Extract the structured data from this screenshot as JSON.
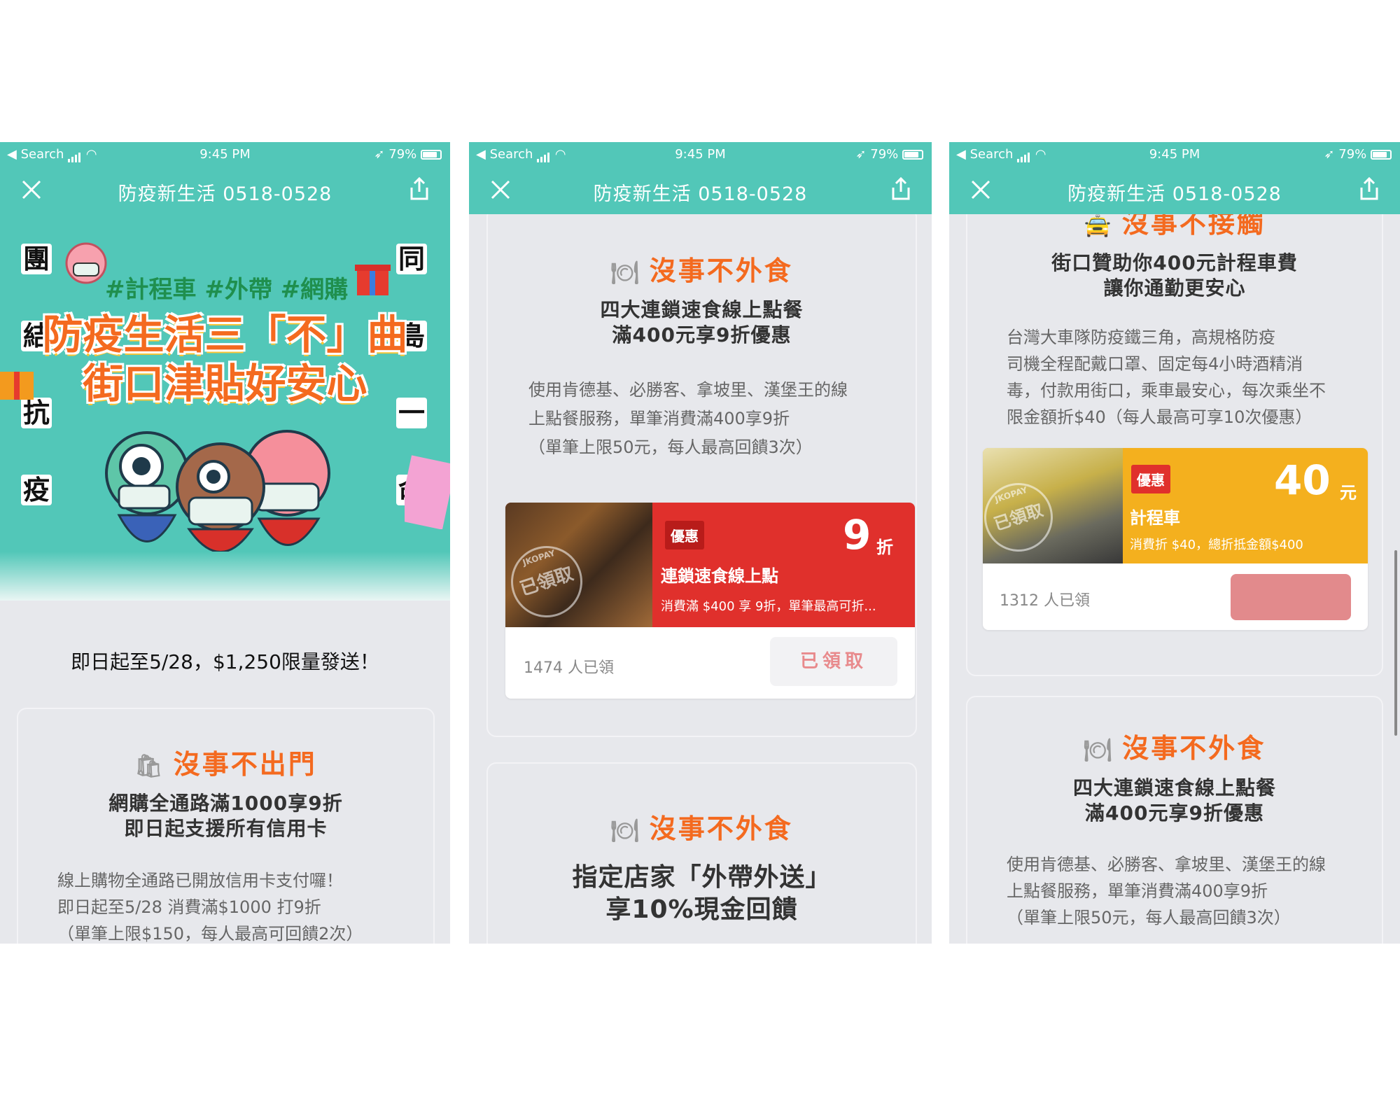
{
  "status": {
    "back_label": "◀ Search",
    "time": "9:45 PM",
    "battery": "79%"
  },
  "nav": {
    "title": "防疫新生活 0518-0528"
  },
  "hero": {
    "left_chars": [
      "團",
      "結",
      "抗",
      "疫"
    ],
    "right_chars": [
      "同",
      "島",
      "一",
      "命"
    ],
    "tagline": "#計程車 #外帶 #網購",
    "title_line1": "防疫生活三「不」曲",
    "title_line2": "街口津貼好安心"
  },
  "screen1": {
    "limit_text": "即日起至5/28，$1,250限量發送！",
    "card": {
      "heading": "沒事不出門",
      "heading_icon": "shopping-bags-icon",
      "sub1": "網購全通路滿1000享9折",
      "sub2": "即日起支援所有信用卡",
      "body1": "線上購物全通路已開放信用卡支付囉！",
      "body2": "即日起至5/28 消費滿$1000 打9折",
      "body3": "（單筆上限$150，每人最高可回饋2次）"
    }
  },
  "screen2": {
    "card1": {
      "heading": "沒事不外食",
      "heading_icon": "dining-plate-icon",
      "sub1": "四大連鎖速食線上點餐",
      "sub2": "滿400元享9折優惠",
      "body1": "使用肯德基、必勝客、拿坡里、漢堡王的線",
      "body2": "上點餐服務，單筆消費滿400享9折",
      "body3": "（單筆上限50元，每人最高回饋3次）",
      "coupon": {
        "badge": "優惠",
        "name": "連鎖速食線上點",
        "value": "9",
        "unit": "折",
        "detail": "消費滿 $400 享 9折，單筆最高可折...",
        "stamp": "已領取",
        "stamp_ring": "JKOPAY",
        "count": "1474 人已領",
        "button": "已領取",
        "color": "#e0302c"
      }
    },
    "card2": {
      "heading": "沒事不外食",
      "heading_icon": "dining-plate-icon",
      "sub1": "指定店家「外帶外送」",
      "sub2": "享10%現金回饋"
    }
  },
  "screen3": {
    "card1": {
      "heading": "沒事不接觸",
      "heading_icon": "taxi-icon",
      "sub1": "街口贊助你400元計程車費",
      "sub2": "讓你通勤更安心",
      "body1": "台灣大車隊防疫鐵三角，高規格防疫",
      "body2": "司機全程配戴口罩、固定每4小時酒精消",
      "body3": "毒，付款用街口，乘車最安心，每次乘坐不",
      "body4": "限金額折$40（每人最高可享10次優惠）",
      "coupon": {
        "badge": "優惠",
        "name": "計程車",
        "value": "40",
        "unit": "元",
        "detail": "消費折 $40，總折抵金額$400",
        "stamp": "已領取",
        "stamp_ring": "JKOPAY",
        "count": "1312 人已領",
        "color": "#f4b01e"
      }
    },
    "card2": {
      "heading": "沒事不外食",
      "heading_icon": "dining-plate-icon",
      "sub1": "四大連鎖速食線上點餐",
      "sub2": "滿400元享9折優惠",
      "body1": "使用肯德基、必勝客、拿坡里、漢堡王的線",
      "body2": "上點餐服務，單筆消費滿400享9折",
      "body3": "（單筆上限50元，每人最高回饋3次）"
    }
  },
  "colors": {
    "teal": "#52c7b8",
    "orange": "#f46a1f",
    "red": "#e0302c",
    "yellow": "#f4b01e",
    "pink": "#e28a8c"
  }
}
